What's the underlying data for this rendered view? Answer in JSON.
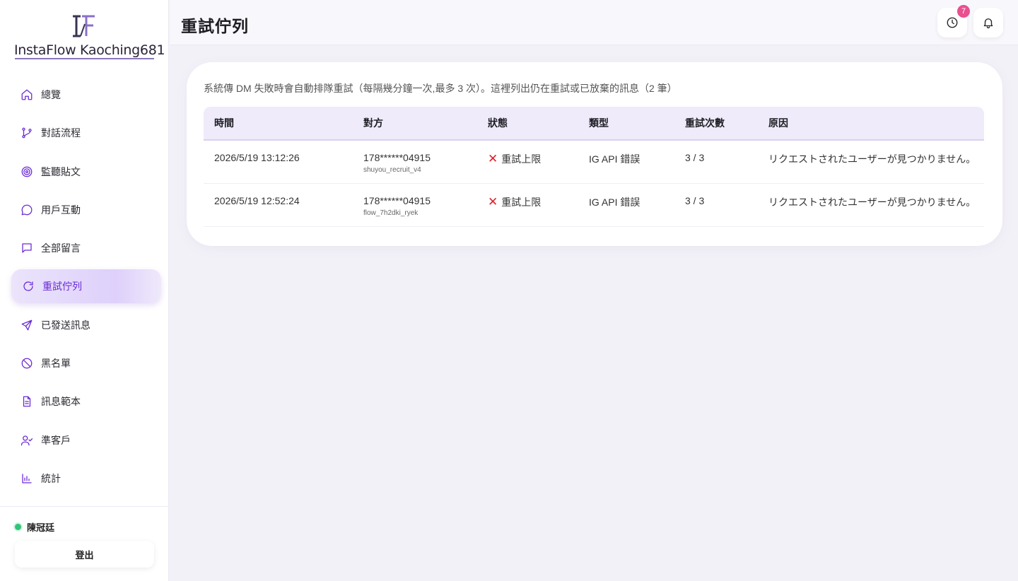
{
  "brand": {
    "logo_text": "InstaFlow Kaoching681"
  },
  "sidebar": {
    "items": [
      {
        "label": "總覽",
        "icon": "home-icon",
        "active": false
      },
      {
        "label": "對話流程",
        "icon": "flow-branch-icon",
        "active": false
      },
      {
        "label": "監聽貼文",
        "icon": "target-icon",
        "active": false
      },
      {
        "label": "用戶互動",
        "icon": "chat-bubble-icon",
        "active": false
      },
      {
        "label": "全部留言",
        "icon": "message-square-icon",
        "active": false
      },
      {
        "label": "重試佇列",
        "icon": "refresh-icon",
        "active": true
      },
      {
        "label": "已發送訊息",
        "icon": "send-icon",
        "active": false
      },
      {
        "label": "黑名單",
        "icon": "ban-icon",
        "active": false
      },
      {
        "label": "訊息範本",
        "icon": "file-text-icon",
        "active": false
      },
      {
        "label": "準客戶",
        "icon": "user-check-icon",
        "active": false
      },
      {
        "label": "統計",
        "icon": "bar-chart-icon",
        "active": false
      }
    ],
    "user": {
      "name": "陳冠廷",
      "status": "online",
      "status_color": "#2fc57a"
    },
    "logout_label": "登出"
  },
  "header": {
    "title": "重試佇列",
    "history_badge": "7",
    "accent": "#6a2bd6"
  },
  "main": {
    "description": "系統傳 DM 失敗時會自動排隊重試（每隔幾分鐘一次,最多 3 次）。這裡列出仍在重試或已放棄的訊息（2 筆）",
    "columns": [
      "時間",
      "對方",
      "狀態",
      "類型",
      "重試次數",
      "原因"
    ],
    "rows": [
      {
        "time": "2026/5/19 13:12:26",
        "recipient": "178******04915",
        "flow": "shuyou_recruit_v4",
        "status": "重試上限",
        "type": "IG API 錯誤",
        "retries": "3 / 3",
        "reason": "リクエストされたユーザーが見つかりません。"
      },
      {
        "time": "2026/5/19 12:52:24",
        "recipient": "178******04915",
        "flow": "flow_7h2dki_ryek",
        "status": "重試上限",
        "type": "IG API 錯誤",
        "retries": "3 / 3",
        "reason": "リクエストされたユーザーが見つかりません。"
      }
    ]
  }
}
